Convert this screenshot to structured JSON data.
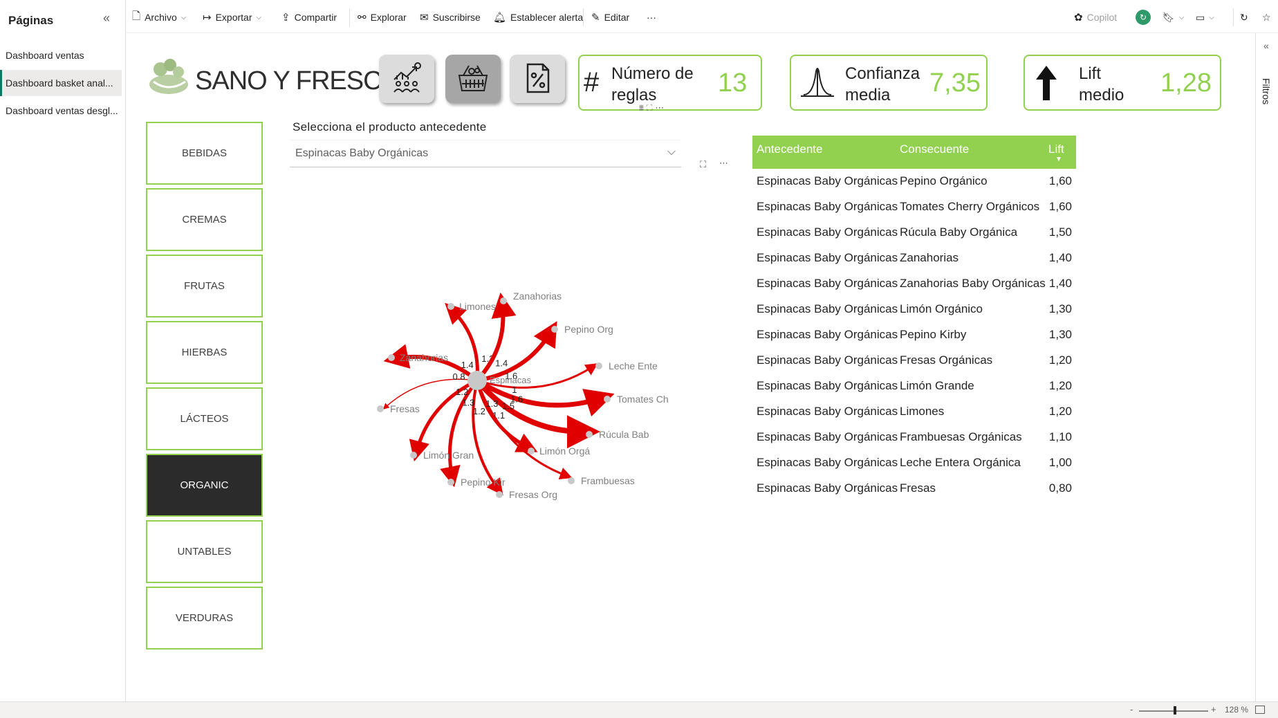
{
  "pages_panel": {
    "title": "Páginas",
    "items": [
      {
        "label": "Dashboard ventas"
      },
      {
        "label": "Dashboard basket anal..."
      },
      {
        "label": "Dashboard ventas desgl..."
      }
    ]
  },
  "toolbar": {
    "archivo": "Archivo",
    "exportar": "Exportar",
    "compartir": "Compartir",
    "explorar": "Explorar",
    "suscribirse": "Suscribirse",
    "alerta": "Establecer alerta",
    "editar": "Editar",
    "more": "···",
    "copilot": "Copilot"
  },
  "header": {
    "brand": "SANO Y FRESCO",
    "nav_icons": [
      "sales-chart-icon",
      "basket-icon",
      "percent-icon"
    ],
    "kpis": [
      {
        "title": "Número de reglas",
        "value": "13",
        "icon": "hash-icon"
      },
      {
        "title": "Confianza media",
        "value": "7,35",
        "icon": "bell-curve-icon"
      },
      {
        "title": "Lift medio",
        "value": "1,28",
        "icon": "arrow-up-icon"
      }
    ]
  },
  "categories": [
    {
      "label": "BEBIDAS"
    },
    {
      "label": "CREMAS"
    },
    {
      "label": "FRUTAS"
    },
    {
      "label": "HIERBAS"
    },
    {
      "label": "LÁCTEOS"
    },
    {
      "label": "ORGANIC"
    },
    {
      "label": "UNTABLES"
    },
    {
      "label": "VERDURAS"
    }
  ],
  "active_category": "ORGANIC",
  "slicer": {
    "label": "Selecciona el producto antecedente",
    "value": "Espinacas Baby Orgánicas"
  },
  "graph": {
    "center_label": "Espinacas",
    "nodes": [
      {
        "label": "Limones",
        "lift": "1.2"
      },
      {
        "label": "Zanahorias",
        "lift": "1.4"
      },
      {
        "label": "Pepino Org",
        "lift": "1.6"
      },
      {
        "label": "Leche Ente",
        "lift": "1"
      },
      {
        "label": "Tomates Ch",
        "lift": "1.6"
      },
      {
        "label": "Rúcula Bab",
        "lift": "1.5"
      },
      {
        "label": "Frambuesas",
        "lift": "1.1"
      },
      {
        "label": "Limón Orgá",
        "lift": "1.3"
      },
      {
        "label": "Fresas Org",
        "lift": "1.2"
      },
      {
        "label": "Pepino Kir",
        "lift": "1.3"
      },
      {
        "label": "Limón Gran",
        "lift": "1.2"
      },
      {
        "label": "Fresas",
        "lift": "0.8"
      },
      {
        "label": "Zanahorias",
        "lift": "1.4"
      }
    ]
  },
  "table": {
    "headers": [
      "Antecedente",
      "Consecuente",
      "Lift"
    ],
    "rows": [
      {
        "ant": "Espinacas Baby Orgánicas",
        "con": "Pepino Orgánico",
        "lift": "1,60"
      },
      {
        "ant": "Espinacas Baby Orgánicas",
        "con": "Tomates Cherry Orgánicos",
        "lift": "1,60"
      },
      {
        "ant": "Espinacas Baby Orgánicas",
        "con": "Rúcula Baby Orgánica",
        "lift": "1,50"
      },
      {
        "ant": "Espinacas Baby Orgánicas",
        "con": "Zanahorias",
        "lift": "1,40"
      },
      {
        "ant": "Espinacas Baby Orgánicas",
        "con": "Zanahorias Baby Orgánicas",
        "lift": "1,40"
      },
      {
        "ant": "Espinacas Baby Orgánicas",
        "con": "Limón Orgánico",
        "lift": "1,30"
      },
      {
        "ant": "Espinacas Baby Orgánicas",
        "con": "Pepino Kirby",
        "lift": "1,30"
      },
      {
        "ant": "Espinacas Baby Orgánicas",
        "con": "Fresas Orgánicas",
        "lift": "1,20"
      },
      {
        "ant": "Espinacas Baby Orgánicas",
        "con": "Limón Grande",
        "lift": "1,20"
      },
      {
        "ant": "Espinacas Baby Orgánicas",
        "con": "Limones",
        "lift": "1,20"
      },
      {
        "ant": "Espinacas Baby Orgánicas",
        "con": "Frambuesas Orgánicas",
        "lift": "1,10"
      },
      {
        "ant": "Espinacas Baby Orgánicas",
        "con": "Leche Entera Orgánica",
        "lift": "1,00"
      },
      {
        "ant": "Espinacas Baby Orgánicas",
        "con": "Fresas",
        "lift": "0,80"
      }
    ]
  },
  "filters_label": "Filtros",
  "statusbar": {
    "zoom": "128 %",
    "minus": "-",
    "plus": "+"
  },
  "colors": {
    "accent": "#92d050",
    "edge": "#e00000",
    "active_button": "#2b2b2b"
  }
}
